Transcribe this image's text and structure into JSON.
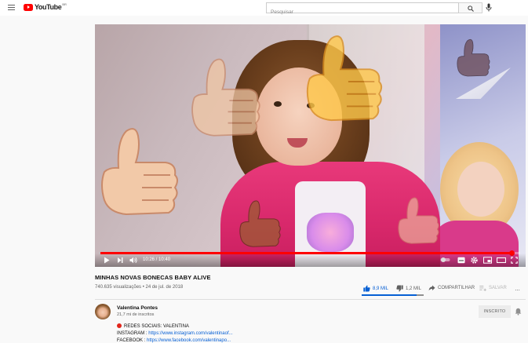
{
  "header": {
    "logo_text": "YouTube",
    "logo_region": "BR",
    "search_placeholder": "Pesquisar",
    "search_value": ""
  },
  "player": {
    "current_time": "10:26",
    "duration": "10:40",
    "progress_fraction": 0.98
  },
  "video": {
    "title": "MINHAS NOVAS BONECAS BABY ALIVE",
    "views": "740.635 visualizações",
    "date": "24 de jul. de 2018",
    "likes": "8,9 MIL",
    "dislikes": "1,2 MIL",
    "share_label": "COMPARTILHAR",
    "save_label": "SALVAR",
    "more_label": "···",
    "like_ratio": 0.88
  },
  "channel": {
    "name": "Valentina Pontes",
    "subscribers": "21,7 mi de inscritos",
    "subscribe_label": "INSCRITO"
  },
  "description": {
    "line1": "REDES SOCIAIS: VALENTINA",
    "line2_label": "INSTAGRAM : ",
    "line2_link": "https://www.instagram.com/valentinaof...",
    "line3_label": "FACEBOOK : ",
    "line3_link": "https://www.facebook.com/valentinapo..."
  },
  "colors": {
    "brand_red": "#ff0000",
    "link_blue": "#065fd4",
    "text_secondary": "#606060"
  }
}
